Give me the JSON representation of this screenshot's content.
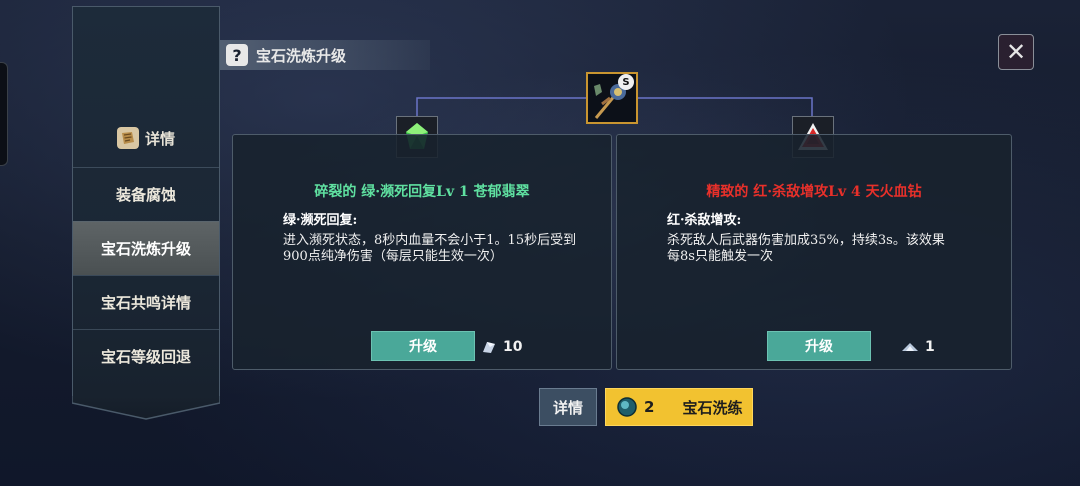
{
  "title_bar": {
    "title": "宝石洗炼升级",
    "icon": "question-icon"
  },
  "sidebar": {
    "header": {
      "label": "详情",
      "icon": "scroll-icon"
    },
    "items": [
      {
        "label": "装备腐蚀",
        "active": false
      },
      {
        "label": "宝石洗炼升级",
        "active": true
      },
      {
        "label": "宝石共鸣详情",
        "active": false
      },
      {
        "label": "宝石等级回退",
        "active": false
      }
    ]
  },
  "top_item": {
    "badge": "S",
    "icon": "staff-weapon-icon"
  },
  "cards": [
    {
      "gem_icon": "green-gem-icon",
      "title": "碎裂的 绿·濒死回复Lv 1 苍郁翡翠",
      "title_color": "#5fe0a0",
      "subtitle": "绿·濒死回复:",
      "description": "进入濒死状态，8秒内血量不会小于1。15秒后受到900点纯净伤害（每层只能生效一次）",
      "button": "升级",
      "cost_icon": "crystal-shard-icon",
      "cost": "10"
    },
    {
      "gem_icon": "red-triangle-gem-icon",
      "title": "精致的 红·杀敌增攻Lv 4 天火血钻",
      "title_color": "#e8302a",
      "subtitle": "红·杀敌增攻:",
      "description": "杀死敌人后武器伤害加成35%，持续3s。该效果每8s只能触发一次",
      "button": "升级",
      "cost_icon": "crystal-shard-icon",
      "cost": "1"
    }
  ],
  "bottom": {
    "detail_button": "详情",
    "refine_button": {
      "icon": "refine-stone-icon",
      "count": "2",
      "label": "宝石洗练"
    }
  },
  "close_icon": "close-icon",
  "colors": {
    "accent_yellow": "#f2c230",
    "upgrade_teal": "#4aa899"
  }
}
